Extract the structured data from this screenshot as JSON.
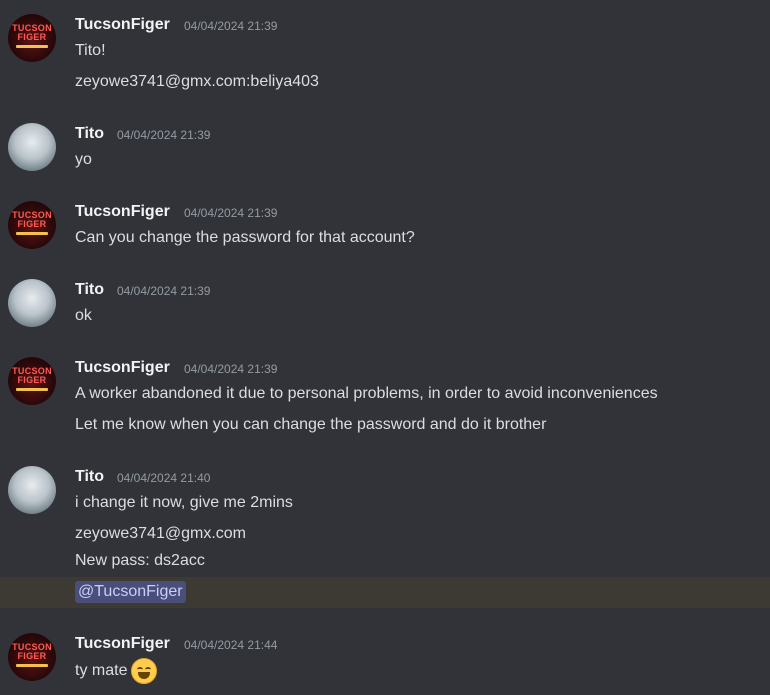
{
  "messages": [
    {
      "user": "TucsonFiger",
      "time": "04/04/2024 21:39",
      "lines": [
        "Tito!",
        "zeyowe3741@gmx.com:beliya403"
      ]
    },
    {
      "user": "Tito",
      "time": "04/04/2024 21:39",
      "lines": [
        "yo"
      ]
    },
    {
      "user": "TucsonFiger",
      "time": "04/04/2024 21:39",
      "lines": [
        "Can you change the password for that account?"
      ]
    },
    {
      "user": "Tito",
      "time": "04/04/2024 21:39",
      "lines": [
        "ok"
      ]
    },
    {
      "user": "TucsonFiger",
      "time": "04/04/2024 21:39",
      "lines": [
        "A worker abandoned it due to personal problems, in order to avoid inconveniences",
        "Let me know when you can change the password and do it brother"
      ]
    },
    {
      "user": "Tito",
      "time": "04/04/2024 21:40",
      "lines": [
        "i change it now, give me 2mins",
        "zeyowe3741@gmx.com",
        "New pass: ds2acc"
      ],
      "mention": "@TucsonFiger"
    },
    {
      "user": "TucsonFiger",
      "time": "04/04/2024 21:44",
      "lines": [
        "ty mate"
      ]
    }
  ],
  "avatar_logo": "TUCSON FIGER",
  "emoji": "grinning-face-emoji",
  "colors": {
    "background": "#313338",
    "mention_bg": "#4a4f7a",
    "highlight_bg": "#3c3a33"
  }
}
